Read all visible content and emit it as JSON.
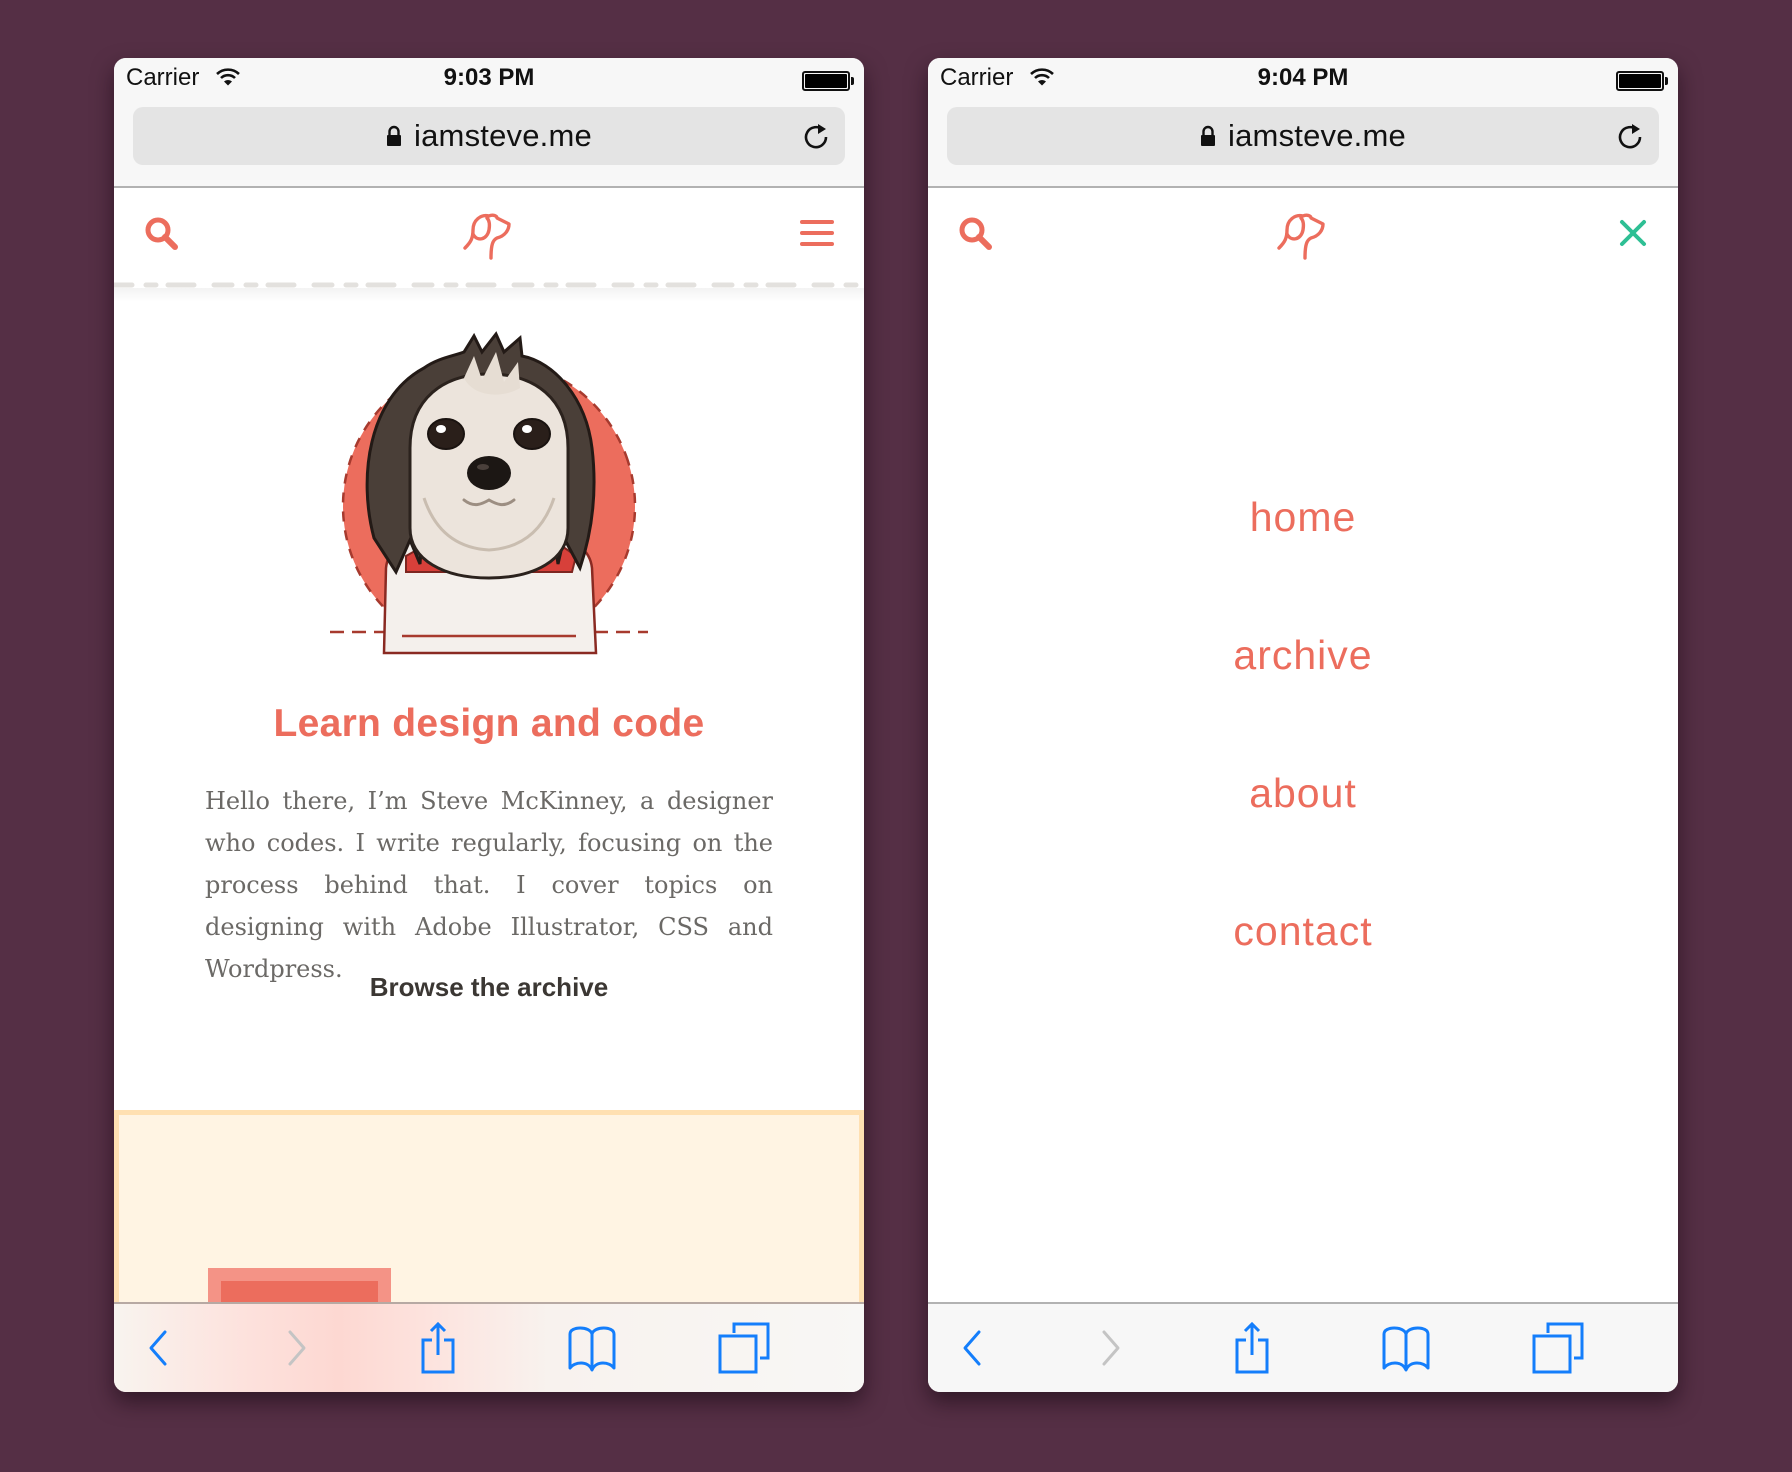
{
  "screens": [
    {
      "status_bar": {
        "carrier": "Carrier",
        "time": "9:03 PM",
        "battery_level": "full"
      },
      "browser": {
        "url": "iamsteve.me",
        "secure": true
      },
      "header": {
        "search_icon": "search-icon",
        "logo_icon": "dog-head-logo-icon",
        "menu_icon": "hamburger-menu-icon"
      },
      "hero": {
        "image_alt": "Illustrated dog portrait",
        "title": "Learn design and code",
        "intro": "Hello there, I’m Steve McKinney, a designer who codes. I write regularly, focusing on the process behind that. I cover topics on designing with Adobe Illustrator, CSS and Wordpress.",
        "browse_link": "Browse the archive"
      },
      "toolbar": {
        "back": "back-chevron-icon",
        "forward": "forward-chevron-icon",
        "share": "share-icon",
        "bookmarks": "bookmarks-book-icon",
        "tabs": "tabs-icon"
      }
    },
    {
      "status_bar": {
        "carrier": "Carrier",
        "time": "9:04 PM",
        "battery_level": "full"
      },
      "browser": {
        "url": "iamsteve.me",
        "secure": true
      },
      "header": {
        "search_icon": "search-icon",
        "logo_icon": "dog-head-logo-icon",
        "close_icon": "close-x-icon"
      },
      "nav": {
        "items": [
          {
            "label": "home"
          },
          {
            "label": "archive"
          },
          {
            "label": "about"
          },
          {
            "label": "contact"
          }
        ]
      },
      "toolbar": {
        "back": "back-chevron-icon",
        "forward": "forward-chevron-icon",
        "share": "share-icon",
        "bookmarks": "bookmarks-book-icon",
        "tabs": "tabs-icon"
      }
    }
  ],
  "colors": {
    "background": "#552f45",
    "accent": "#ec6d5d",
    "close_accent": "#2ebf94",
    "ios_blue": "#147efb",
    "body_text": "#6b6966",
    "link_text": "#3b3733",
    "cream": "#fff4e3",
    "cream_border": "#ffe0b2"
  }
}
